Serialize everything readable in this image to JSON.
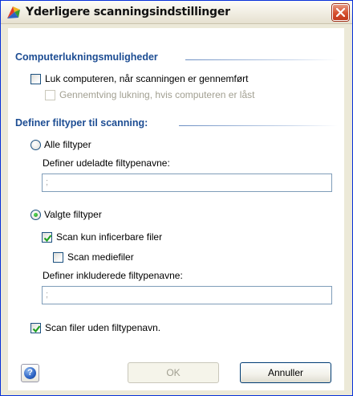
{
  "window": {
    "title": "Yderligere scanningsindstillinger",
    "title_icon": "avg-logo-icon",
    "close_icon": "close-icon"
  },
  "shutdown": {
    "heading": "Computerlukningsmuligheder",
    "shutdown_after_scan": {
      "label": "Luk computeren, når scanningen er gennemført",
      "checked": false
    },
    "force_shutdown": {
      "label": "Gennemtving lukning, hvis computeren er låst",
      "checked": false,
      "enabled": false
    }
  },
  "filetypes": {
    "heading": "Definer filtyper til scanning:",
    "all_types": {
      "label": "Alle filtyper",
      "selected": false
    },
    "excluded_label": "Definer udeladte filtypenavne:",
    "excluded_value": ";",
    "selected_types": {
      "label": "Valgte filtyper",
      "selected": true
    },
    "infectable_only": {
      "label": "Scan kun inficerbare filer",
      "checked": true
    },
    "media_files": {
      "label": "Scan mediefiler",
      "checked": false
    },
    "included_label": "Definer inkluderede filtypenavne:",
    "included_value": ";",
    "no_extension": {
      "label": "Scan filer uden filtypenavn.",
      "checked": true
    }
  },
  "footer": {
    "help_icon": "help-icon",
    "ok_label": "OK",
    "ok_enabled": false,
    "cancel_label": "Annuller"
  },
  "colors": {
    "heading": "#1d4d93",
    "checkmark": "#21a121",
    "window_border": "#0831d9"
  }
}
